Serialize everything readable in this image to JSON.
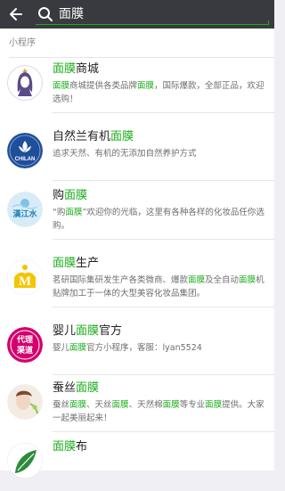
{
  "search": {
    "query": "面膜"
  },
  "section": {
    "title": "小程序"
  },
  "colors": {
    "highlight": "#1aad19",
    "topbar": "#393a3f"
  },
  "results": [
    {
      "icon": "woman-silhouette-logo",
      "name_parts": [
        {
          "t": "面膜",
          "hl": true
        },
        {
          "t": "商城",
          "hl": false
        }
      ],
      "desc_parts": [
        {
          "t": "面膜",
          "hl": true
        },
        {
          "t": "商城提供各类品牌",
          "hl": false
        },
        {
          "t": "面膜",
          "hl": true
        },
        {
          "t": "，国际爆款，全部正品，欢迎选购！",
          "hl": false
        }
      ]
    },
    {
      "icon": "chilan-logo",
      "logo_text": "CHILAN",
      "name_parts": [
        {
          "t": "自然兰有机",
          "hl": false
        },
        {
          "t": "面膜",
          "hl": true
        }
      ],
      "desc_parts": [
        {
          "t": "追求天然、有机的无添加自然养护方式",
          "hl": false
        }
      ]
    },
    {
      "icon": "river-logo",
      "logo_text": "漢江水",
      "name_parts": [
        {
          "t": "购",
          "hl": false
        },
        {
          "t": "面膜",
          "hl": true
        }
      ],
      "desc_parts": [
        {
          "t": "“购",
          "hl": false
        },
        {
          "t": "面膜",
          "hl": true
        },
        {
          "t": "”欢迎你的光临，这里有各种各样的化妆品任你选购。",
          "hl": false
        }
      ]
    },
    {
      "icon": "m-logo",
      "logo_text": "M",
      "name_parts": [
        {
          "t": "面膜",
          "hl": true
        },
        {
          "t": "生产",
          "hl": false
        }
      ],
      "desc_parts": [
        {
          "t": "茗研国际集研发生产各类微商、爆款",
          "hl": false
        },
        {
          "t": "面膜",
          "hl": true
        },
        {
          "t": "及全自动",
          "hl": false
        },
        {
          "t": "面膜",
          "hl": true
        },
        {
          "t": "机贴牌加工于一体的大型美容化妆品集团。",
          "hl": false
        }
      ]
    },
    {
      "icon": "agent-channel-logo",
      "logo_text": "代理渠道",
      "name_parts": [
        {
          "t": "婴儿",
          "hl": false
        },
        {
          "t": "面膜",
          "hl": true
        },
        {
          "t": "官方",
          "hl": false
        }
      ],
      "desc_parts": [
        {
          "t": "婴儿",
          "hl": false
        },
        {
          "t": "面膜",
          "hl": true
        },
        {
          "t": "官方小程序，客服：lyan5524",
          "hl": false
        }
      ]
    },
    {
      "icon": "silk-beauty-logo",
      "name_parts": [
        {
          "t": "蚕丝",
          "hl": false
        },
        {
          "t": "面膜",
          "hl": true
        }
      ],
      "desc_parts": [
        {
          "t": "蚕丝",
          "hl": false
        },
        {
          "t": "面膜",
          "hl": true
        },
        {
          "t": "、天丝",
          "hl": false
        },
        {
          "t": "面膜",
          "hl": true
        },
        {
          "t": "、天然棉",
          "hl": false
        },
        {
          "t": "面膜",
          "hl": true
        },
        {
          "t": "等专业",
          "hl": false
        },
        {
          "t": "面膜",
          "hl": true
        },
        {
          "t": "提供。大家一起美丽起来！",
          "hl": false
        }
      ]
    },
    {
      "icon": "leaf-logo",
      "name_parts": [
        {
          "t": "面膜",
          "hl": true
        },
        {
          "t": "布",
          "hl": false
        }
      ],
      "desc_parts": []
    }
  ]
}
